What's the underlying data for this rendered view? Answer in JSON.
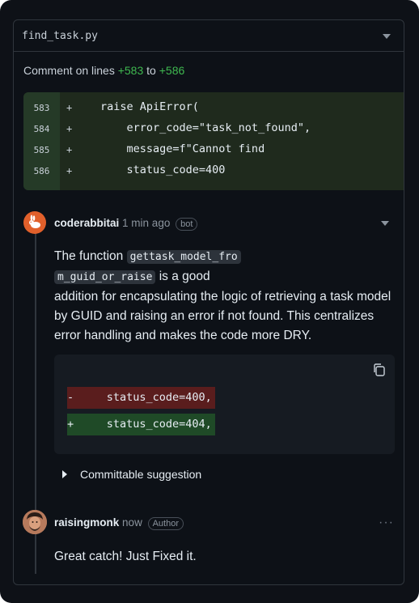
{
  "file": {
    "name": "find_task.py"
  },
  "comment_on": {
    "prefix": "Comment on lines",
    "start": "+583",
    "join": "to",
    "end": "+586"
  },
  "diff_lines": [
    {
      "num": "583",
      "sign": "+",
      "code": "raise ApiError("
    },
    {
      "num": "584",
      "sign": "+",
      "code": "    error_code=\"task_not_found\","
    },
    {
      "num": "585",
      "sign": "+",
      "code": "    message=f\"Cannot find"
    },
    {
      "num": "586",
      "sign": "+",
      "code": "    status_code=400"
    }
  ],
  "comment1": {
    "user": "coderabbitai",
    "time": "1 min ago",
    "badge": "bot",
    "text_before": "The function",
    "code_part1": "gettask_model_fro",
    "code_part2": "m_guid_or_raise",
    "text_after_inline": "is a good",
    "text_rest": "addition for encapsulating the logic of retrieving a task model by GUID and raising an error if not found. This centralizes error handling and makes the code more DRY."
  },
  "suggestion": {
    "removed": "-     status_code=400,",
    "added": "+     status_code=404,",
    "toggle_label": "Committable suggestion"
  },
  "comment2": {
    "user": "raisingmonk",
    "time": "now",
    "badge": "Author",
    "text": "Great catch! Just Fixed it."
  },
  "colors": {
    "added": "#3fb950",
    "accent_avatar": "#e1602b"
  }
}
